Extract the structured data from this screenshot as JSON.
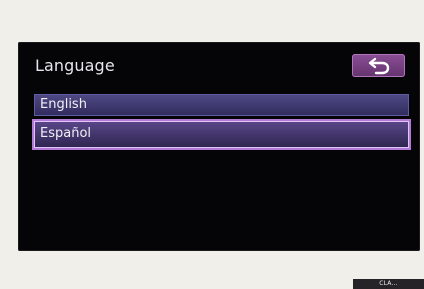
{
  "screen": {
    "title": "Language",
    "back_icon": "back-arrow-icon",
    "languages": [
      {
        "label": "English",
        "selected": false
      },
      {
        "label": "Español",
        "selected": true
      }
    ]
  },
  "watermark": {
    "text": "CLA..."
  },
  "colors": {
    "screen_background": "#050406",
    "button_purple": "#7a4586",
    "list_item_blue": "#403a73",
    "selection_outline": "#b27ad6"
  }
}
